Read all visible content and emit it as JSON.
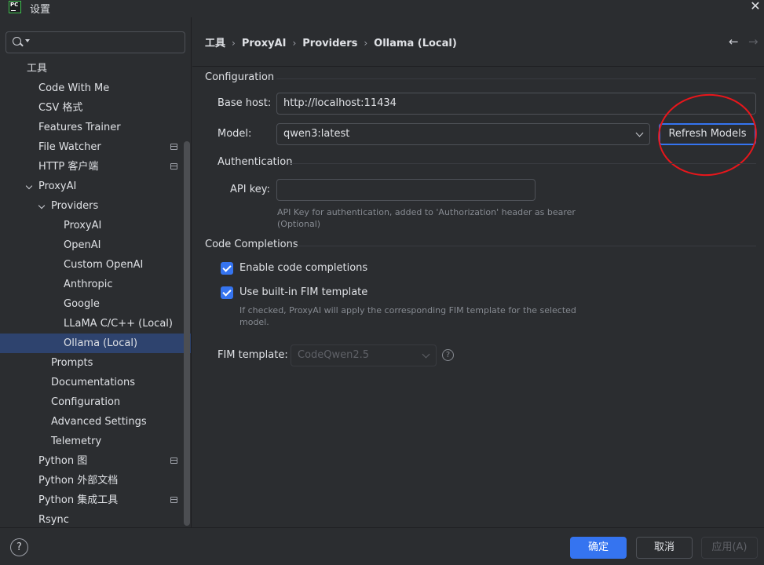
{
  "window": {
    "title": "设置",
    "app_logo": "PC",
    "close": "✕"
  },
  "sidebar": {
    "search": {
      "value": "",
      "placeholder": ""
    },
    "items": [
      {
        "label": "工具"
      },
      {
        "label": "Code With Me"
      },
      {
        "label": "CSV 格式"
      },
      {
        "label": "Features Trainer"
      },
      {
        "label": "File Watcher"
      },
      {
        "label": "HTTP 客户端"
      },
      {
        "label": "ProxyAI"
      },
      {
        "label": "Providers"
      },
      {
        "label": "ProxyAI"
      },
      {
        "label": "OpenAI"
      },
      {
        "label": "Custom OpenAI"
      },
      {
        "label": "Anthropic"
      },
      {
        "label": "Google"
      },
      {
        "label": "LLaMA C/C++ (Local)"
      },
      {
        "label": "Ollama (Local)"
      },
      {
        "label": "Prompts"
      },
      {
        "label": "Documentations"
      },
      {
        "label": "Configuration"
      },
      {
        "label": "Advanced Settings"
      },
      {
        "label": "Telemetry"
      },
      {
        "label": "Python 图"
      },
      {
        "label": "Python 外部文档"
      },
      {
        "label": "Python 集成工具"
      },
      {
        "label": "Rsync"
      }
    ]
  },
  "breadcrumb": [
    "工具",
    "ProxyAI",
    "Providers",
    "Ollama (Local)"
  ],
  "nav": {
    "back": "←",
    "forward": "→"
  },
  "configuration": {
    "title": "Configuration",
    "base_host_label": "Base host:",
    "base_host_value": "http://localhost:11434",
    "model_label": "Model:",
    "model_value": "qwen3:latest",
    "refresh_button": "Refresh Models"
  },
  "authentication": {
    "title": "Authentication",
    "api_key_label": "API key:",
    "api_key_value": "",
    "hint_line1": "API Key for authentication, added to 'Authorization' header as bearer",
    "hint_line2": "(Optional)"
  },
  "code_completions": {
    "title": "Code Completions",
    "enable_label": "Enable code completions",
    "enable_checked": true,
    "fim_builtin_label": "Use built-in FIM template",
    "fim_builtin_checked": true,
    "fim_hint_line1": "If checked, ProxyAI will apply the corresponding FIM template for the selected",
    "fim_hint_line2": "model.",
    "fim_template_label": "FIM template:",
    "fim_template_value": "CodeQwen2.5",
    "help": "?"
  },
  "footer": {
    "help": "?",
    "ok": "确定",
    "cancel": "取消",
    "apply": "应用(A)"
  },
  "colors": {
    "background": "#2b2d30",
    "accent": "#3574f0",
    "selection": "#2e436e",
    "annotation": "#e8161b"
  }
}
